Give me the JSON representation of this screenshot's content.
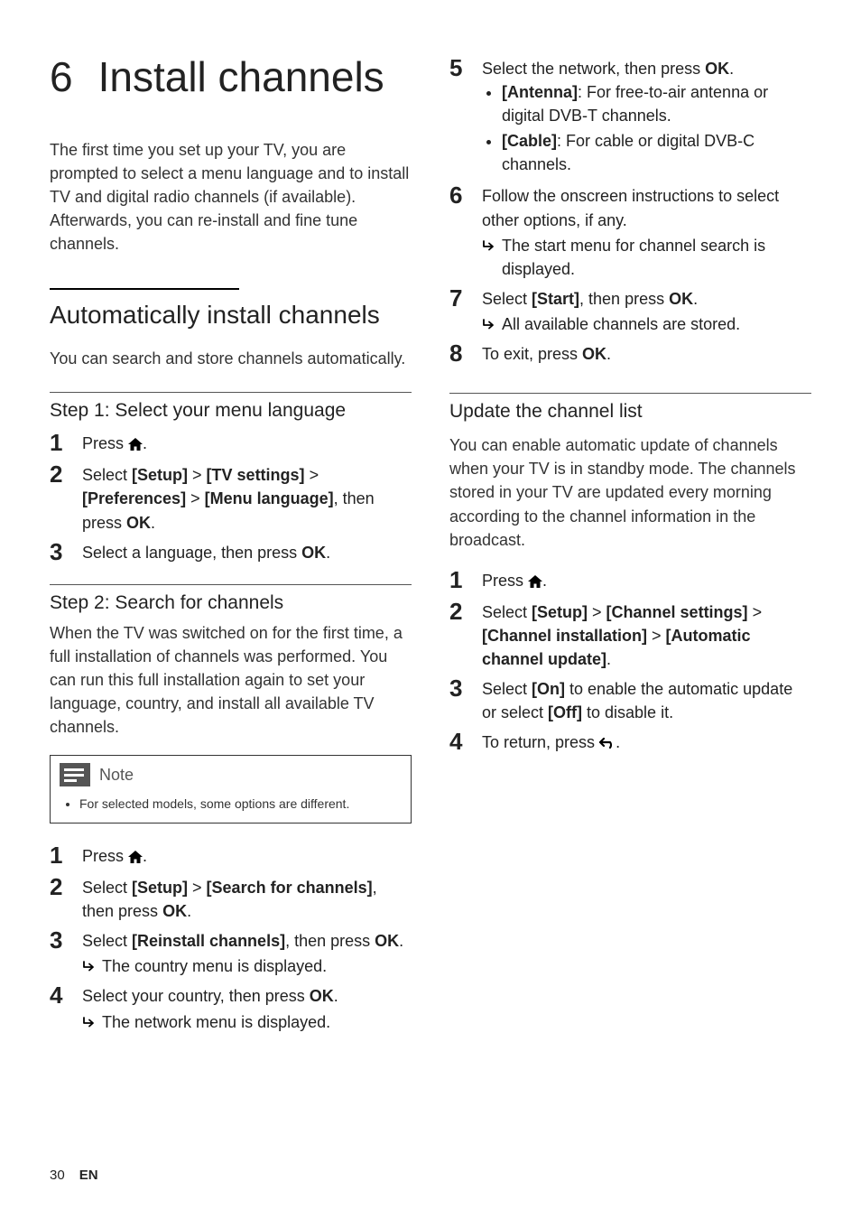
{
  "chapter": {
    "num": "6",
    "title": "Install channels"
  },
  "intro": "The first time you set up your TV, you are prompted to select a menu language and to install TV and digital radio channels (if available). Afterwards, you can re-install and fine tune channels.",
  "auto": {
    "heading": "Automatically install channels",
    "intro": "You can search and store channels automatically.",
    "step1": {
      "heading": "Step 1: Select your menu language",
      "items": [
        {
          "n": "1",
          "parts": [
            "Press ",
            "HOME",
            "."
          ],
          "icon": "home"
        },
        {
          "n": "2",
          "parts": [
            "Select ",
            "[Setup]",
            " > ",
            "[TV settings]",
            " > ",
            "[Preferences]",
            " > ",
            "[Menu language]",
            ", then press ",
            "OK",
            "."
          ]
        },
        {
          "n": "3",
          "parts": [
            "Select a language, then press ",
            "OK",
            "."
          ]
        }
      ]
    },
    "step2": {
      "heading": "Step 2: Search for channels",
      "intro": "When the TV was switched on for the first time, a full installation of channels was performed. You can run this full installation again to set your language, country, and install all available TV channels.",
      "note_title": "Note",
      "note_items": [
        "For selected models, some options are different."
      ],
      "itemsA": [
        {
          "n": "1",
          "parts": [
            "Press ",
            "HOME",
            "."
          ],
          "icon": "home"
        },
        {
          "n": "2",
          "parts": [
            "Select ",
            "[Setup]",
            " > ",
            "[Search for channels]",
            ", then press ",
            "OK",
            "."
          ]
        },
        {
          "n": "3",
          "parts": [
            "Select ",
            "[Reinstall channels]",
            ", then press ",
            "OK",
            "."
          ],
          "result": "The country menu is displayed."
        },
        {
          "n": "4",
          "parts": [
            "Select your country, then press ",
            "OK",
            "."
          ],
          "result": "The network menu is displayed."
        }
      ],
      "itemsB": [
        {
          "n": "5",
          "parts": [
            "Select the network, then press ",
            "OK",
            "."
          ],
          "bullets": [
            {
              "label": "[Antenna]",
              "text": ": For free-to-air antenna or digital DVB-T channels."
            },
            {
              "label": "[Cable]",
              "text": ": For cable or digital DVB-C channels."
            }
          ]
        },
        {
          "n": "6",
          "parts": [
            "Follow the onscreen instructions to select other options, if any."
          ],
          "result": "The start menu for channel search is displayed."
        },
        {
          "n": "7",
          "parts": [
            "Select ",
            "[Start]",
            ", then press ",
            "OK",
            "."
          ],
          "result": "All available channels are stored."
        },
        {
          "n": "8",
          "parts": [
            "To exit, press ",
            "OK",
            "."
          ]
        }
      ]
    }
  },
  "update": {
    "heading": "Update the channel list",
    "intro": "You can enable automatic update of channels when your TV is in standby mode. The channels stored in your TV are updated every morning according to the channel information in the broadcast.",
    "items": [
      {
        "n": "1",
        "parts": [
          "Press ",
          "HOME",
          "."
        ],
        "icon": "home"
      },
      {
        "n": "2",
        "parts": [
          "Select ",
          "[Setup]",
          " > ",
          "[Channel settings]",
          " > ",
          "[Channel installation]",
          " > ",
          "[Automatic channel update]",
          "."
        ]
      },
      {
        "n": "3",
        "parts": [
          "Select ",
          "[On]",
          " to enable the automatic update or select ",
          "[Off]",
          " to disable it."
        ]
      },
      {
        "n": "4",
        "parts": [
          "To return, press ",
          "BACK",
          "."
        ],
        "icon": "back"
      }
    ]
  },
  "footer": {
    "page": "30",
    "lang": "EN"
  }
}
